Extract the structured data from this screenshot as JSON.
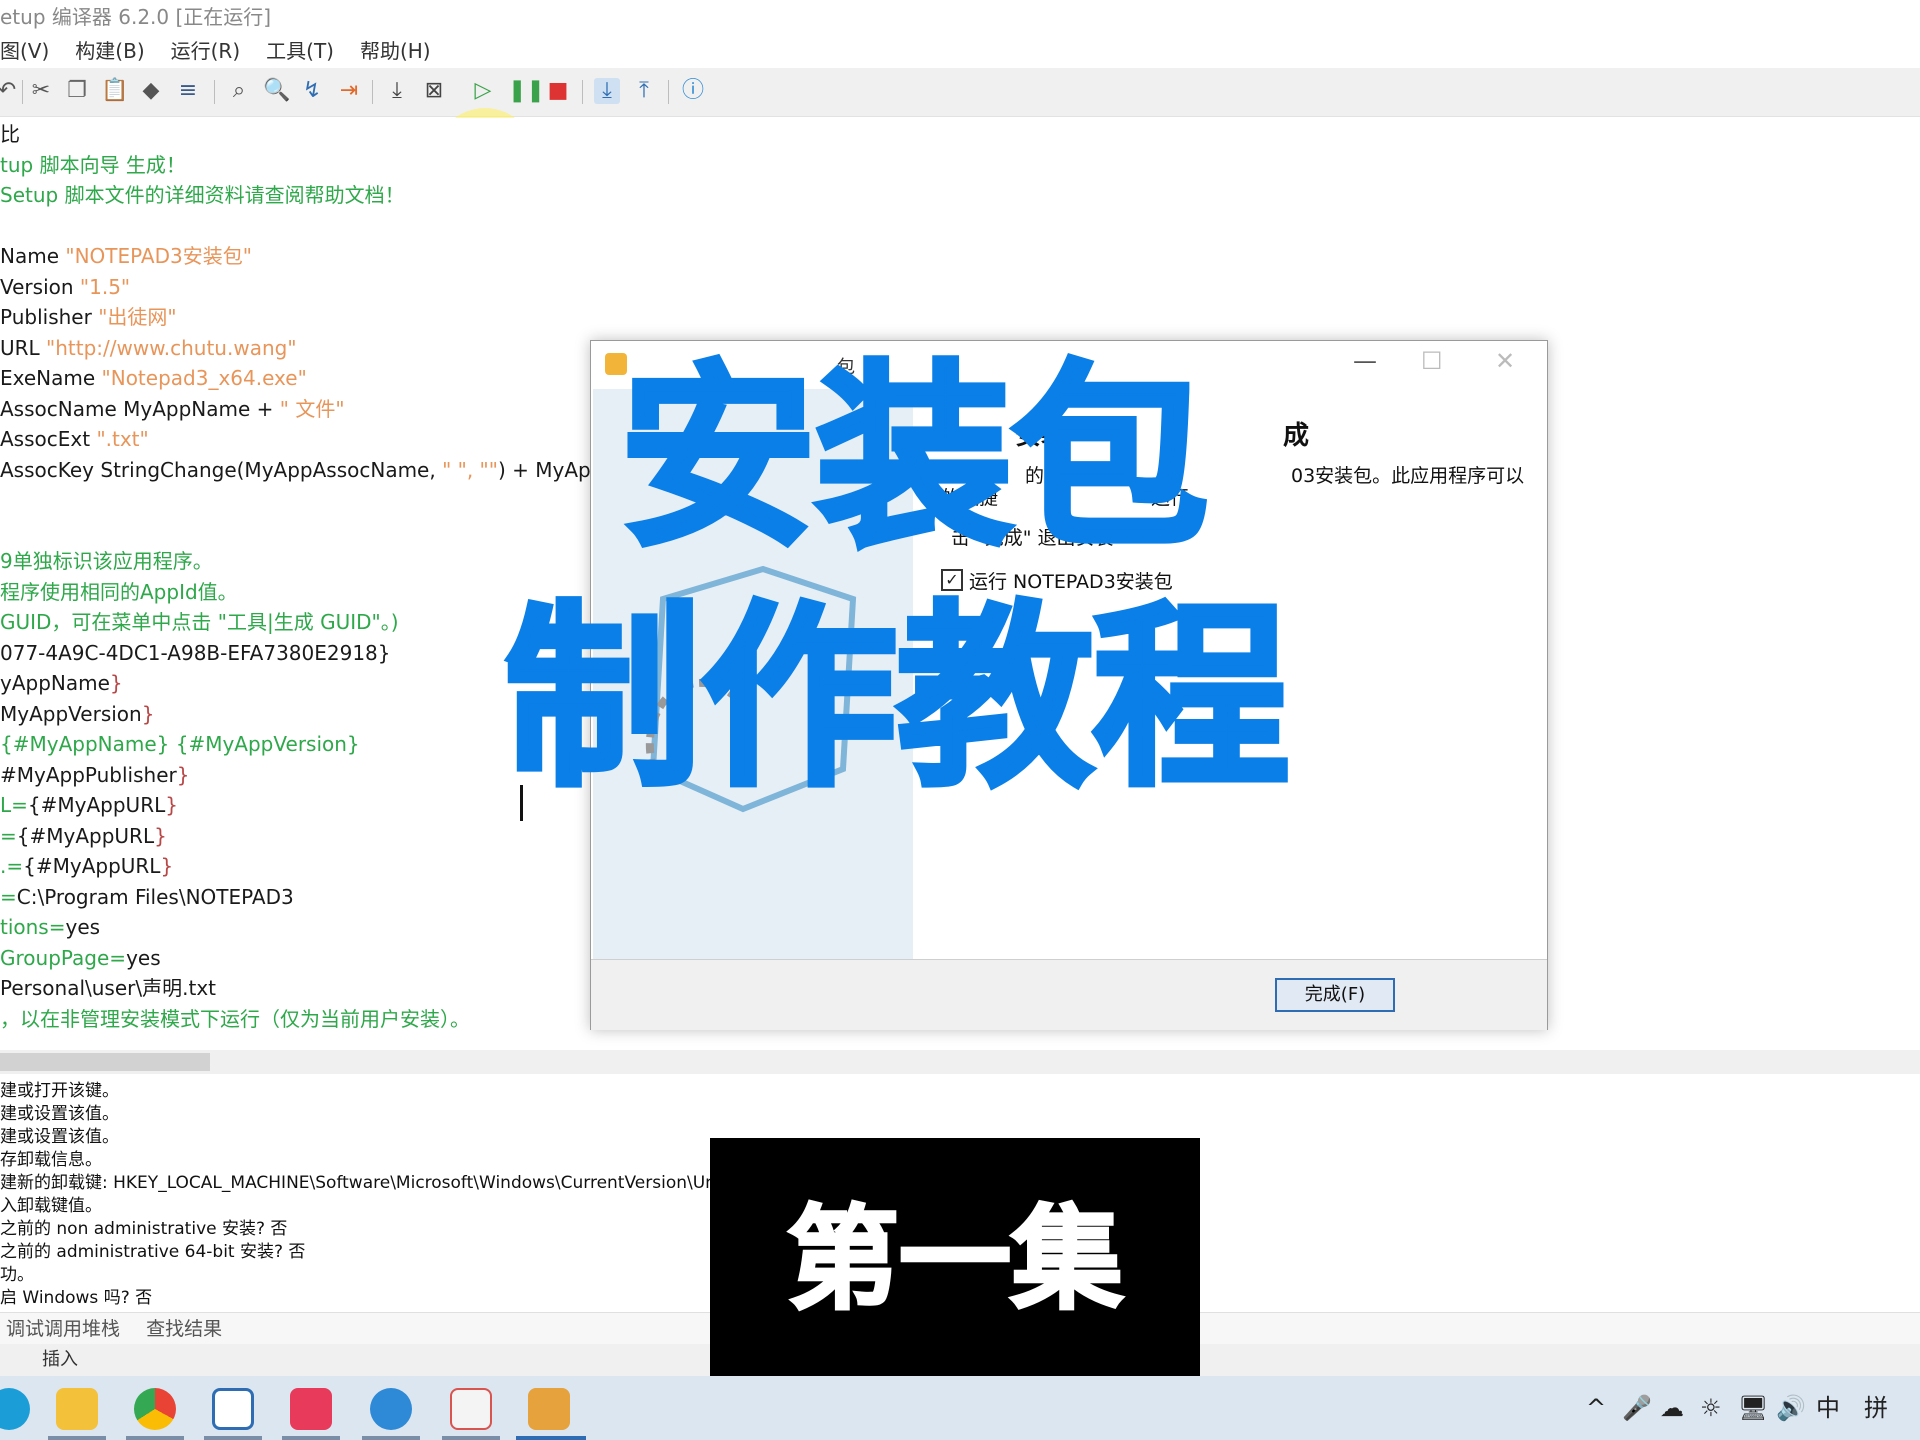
{
  "app": {
    "title": "etup 编译器 6.2.0  [正在运行]",
    "menu": [
      "图(V)",
      "构建(B)",
      "运行(R)",
      "工具(T)",
      "帮助(H)"
    ]
  },
  "toolbar": {
    "icons": [
      "undo-icon",
      "cut-icon",
      "copy-icon",
      "paste-icon",
      "eraser-icon",
      "format-icon",
      "find-icon",
      "find-replace-icon",
      "goto-icon",
      "bookmark-icon",
      "compile-icon",
      "compile-stop-icon",
      "run-icon",
      "pause-icon",
      "stop-icon",
      "install-icon",
      "uninstall-icon",
      "help-icon"
    ]
  },
  "editor": {
    "lines": [
      {
        "segments": [
          {
            "t": "比",
            "c": "c-black"
          }
        ]
      },
      {
        "segments": [
          {
            "t": "tup 脚本向导 生成！",
            "c": "c-green"
          }
        ]
      },
      {
        "segments": [
          {
            "t": "Setup 脚本文件的详细资料请查阅帮助文档！",
            "c": "c-green"
          }
        ]
      },
      {
        "segments": [
          {
            "t": "",
            "c": "c-black"
          }
        ]
      },
      {
        "segments": [
          {
            "t": "Name ",
            "c": "c-black"
          },
          {
            "t": "\"NOTEPAD3安装包\"",
            "c": "c-str"
          }
        ]
      },
      {
        "segments": [
          {
            "t": "Version ",
            "c": "c-black"
          },
          {
            "t": "\"1.5\"",
            "c": "c-str"
          }
        ]
      },
      {
        "segments": [
          {
            "t": "Publisher ",
            "c": "c-black"
          },
          {
            "t": "\"出徒网\"",
            "c": "c-str"
          }
        ]
      },
      {
        "segments": [
          {
            "t": "URL ",
            "c": "c-black"
          },
          {
            "t": "\"http://www.chutu.wang\"",
            "c": "c-str"
          }
        ]
      },
      {
        "segments": [
          {
            "t": "ExeName ",
            "c": "c-black"
          },
          {
            "t": "\"Notepad3_x64.exe\"",
            "c": "c-str"
          }
        ]
      },
      {
        "segments": [
          {
            "t": "AssocName MyAppName + ",
            "c": "c-black"
          },
          {
            "t": "\" 文件\"",
            "c": "c-str"
          }
        ]
      },
      {
        "segments": [
          {
            "t": "AssocExt ",
            "c": "c-black"
          },
          {
            "t": "\".txt\"",
            "c": "c-str"
          }
        ]
      },
      {
        "segments": [
          {
            "t": "AssocKey StringChange(MyAppAssocName, ",
            "c": "c-black"
          },
          {
            "t": "\" \", \"\"",
            "c": "c-str"
          },
          {
            "t": ") + MyApp",
            "c": "c-black"
          }
        ]
      },
      {
        "segments": [
          {
            "t": "",
            "c": "c-black"
          }
        ]
      },
      {
        "segments": [
          {
            "t": "",
            "c": "c-black"
          }
        ]
      },
      {
        "segments": [
          {
            "t": "9单独标识该应用程序。",
            "c": "c-green"
          }
        ]
      },
      {
        "segments": [
          {
            "t": "程序使用相同的AppId值。",
            "c": "c-green"
          }
        ]
      },
      {
        "segments": [
          {
            "t": "GUID，可在菜单中点击 \"工具|生成 GUID\"。)",
            "c": "c-green"
          }
        ]
      },
      {
        "segments": [
          {
            "t": "077-4A9C-4DC1-A98B-EFA7380E2918}",
            "c": "c-black"
          }
        ]
      },
      {
        "segments": [
          {
            "t": "yAppName",
            "c": "c-black"
          },
          {
            "t": "}",
            "c": "c-const"
          }
        ]
      },
      {
        "segments": [
          {
            "t": "MyAppVersion",
            "c": "c-black"
          },
          {
            "t": "}",
            "c": "c-const"
          }
        ]
      },
      {
        "segments": [
          {
            "t": "{#MyAppName} {#MyAppVersion}",
            "c": "c-green"
          }
        ]
      },
      {
        "segments": [
          {
            "t": "#MyAppPublisher",
            "c": "c-black"
          },
          {
            "t": "}",
            "c": "c-const"
          }
        ]
      },
      {
        "segments": [
          {
            "t": "L=",
            "c": "c-green"
          },
          {
            "t": "{#MyAppURL",
            "c": "c-black"
          },
          {
            "t": "}",
            "c": "c-const"
          }
        ]
      },
      {
        "segments": [
          {
            "t": "=",
            "c": "c-green"
          },
          {
            "t": "{#MyAppURL",
            "c": "c-black"
          },
          {
            "t": "}",
            "c": "c-const"
          }
        ]
      },
      {
        "segments": [
          {
            "t": ".=",
            "c": "c-green"
          },
          {
            "t": "{#MyAppURL",
            "c": "c-black"
          },
          {
            "t": "}",
            "c": "c-const"
          }
        ]
      },
      {
        "segments": [
          {
            "t": "=",
            "c": "c-green"
          },
          {
            "t": "C:\\Program Files\\NOTEPAD3",
            "c": "c-black"
          }
        ]
      },
      {
        "segments": [
          {
            "t": "tions=",
            "c": "c-green"
          },
          {
            "t": "yes",
            "c": "c-black"
          }
        ]
      },
      {
        "segments": [
          {
            "t": "GroupPage=",
            "c": "c-green"
          },
          {
            "t": "yes",
            "c": "c-black"
          }
        ]
      },
      {
        "segments": [
          {
            "t": "Personal\\user\\声明.txt",
            "c": "c-black"
          }
        ]
      },
      {
        "segments": [
          {
            "t": "，以在非管理安装模式下运行（仅为当前用户安装）。",
            "c": "c-green"
          }
        ]
      }
    ]
  },
  "output": {
    "lines": [
      "建或打开该键。",
      "建或设置该值。",
      "建或设置该值。",
      "存卸载信息。",
      "建新的卸载键: HKEY_LOCAL_MACHINE\\Software\\Microsoft\\Windows\\CurrentVersion\\Unins",
      "入卸载键值。",
      "之前的 non administrative 安装? 否",
      "之前的 administrative 64-bit 安装? 否",
      "功。",
      "启 Windows 吗? 否"
    ],
    "tabs": [
      "调试调用堆栈",
      "查找结果"
    ]
  },
  "statusbar": {
    "mode": "插入"
  },
  "dialog": {
    "title_fragment": "包",
    "heading_fragment_left": "安装",
    "heading_fragment_right": "成",
    "body_left_1": "的电",
    "body_left_2": "的快捷",
    "body_right_1": "03安装包。此应用程序可以",
    "body_right_2": "运行。",
    "body_3": "击 \"完成\" 退出安装",
    "checkbox_label": "运行 NOTEPAD3安装包",
    "checkbox_checked": true,
    "finish_button": "完成(F)"
  },
  "overlay": {
    "line1": "安装包",
    "line2": "制作教程",
    "episode": "第一集",
    "accent_color": "#0a7fe8"
  },
  "taskbar": {
    "apps": [
      "edge-icon",
      "file-explorer-icon",
      "chrome-icon",
      "network-drive-icon",
      "xmind-icon",
      "ie-icon",
      "office-icon",
      "inno-setup-icon"
    ],
    "tray": [
      "^",
      "🎤",
      "☁",
      "☼",
      "🖥",
      "🔊",
      "中",
      "拼"
    ]
  }
}
